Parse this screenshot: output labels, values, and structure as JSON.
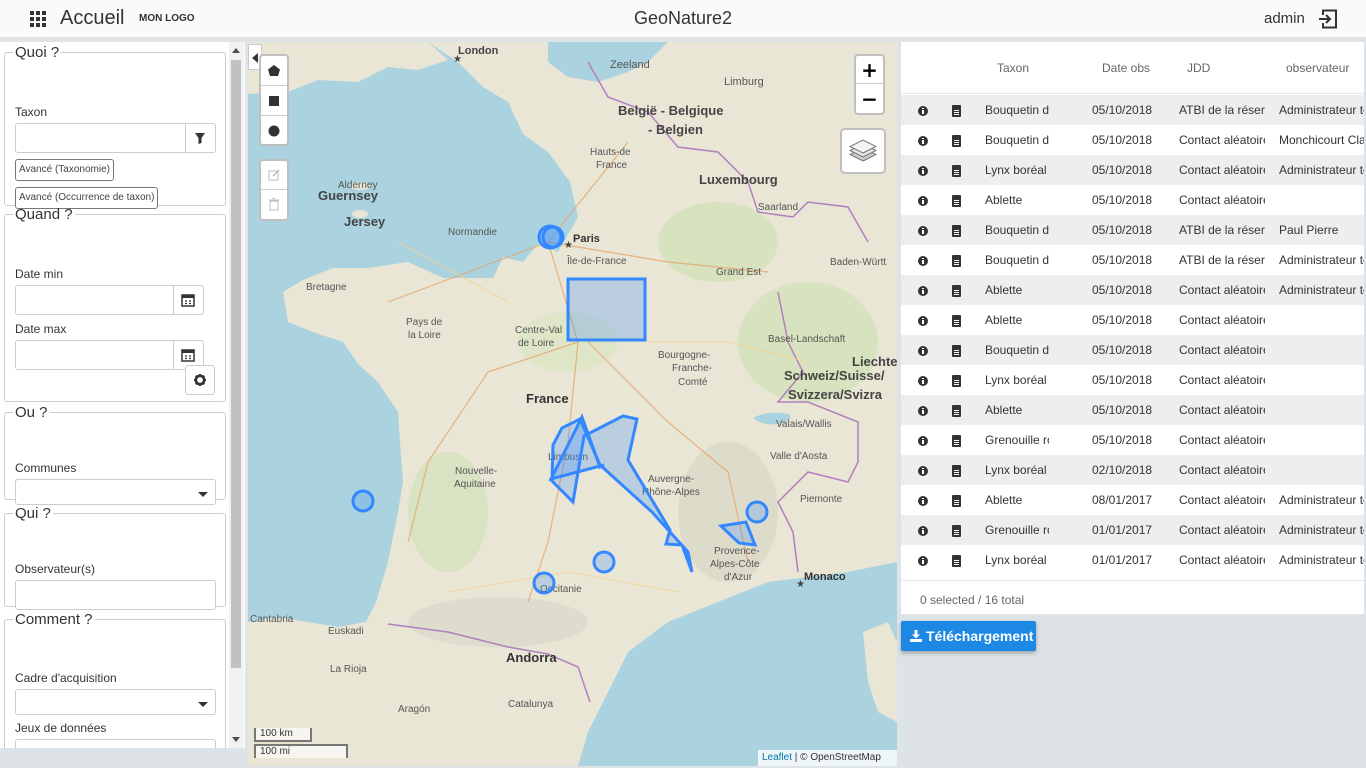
{
  "header": {
    "home_label": "Accueil",
    "logo_text": "MON LOGO",
    "app_title": "GeoNature2",
    "user": "admin"
  },
  "sidebar": {
    "quoi": {
      "legend": "Quoi ?",
      "taxon_label": "Taxon",
      "taxon_value": "",
      "btn_taxonomie": "Avancé (Taxonomie)",
      "btn_occurrence": "Avancé (Occurrence de taxon)"
    },
    "quand": {
      "legend": "Quand ?",
      "date_min_label": "Date min",
      "date_max_label": "Date max"
    },
    "ou": {
      "legend": "Ou ?",
      "communes_label": "Communes"
    },
    "qui": {
      "legend": "Qui ?",
      "observateurs_label": "Observateur(s)"
    },
    "comment": {
      "legend": "Comment ?",
      "cadre_label": "Cadre d'acquisition",
      "jeux_label": "Jeux de données"
    }
  },
  "map": {
    "labels": {
      "london": "London",
      "zeeland": "Zeeland",
      "limburg": "Limburg",
      "belgie1": "België - Belgique",
      "belgie2": "- Belgien",
      "luxembourg": "Luxembourg",
      "guernsey": "Guernsey",
      "jersey": "Jersey",
      "alderney": "Alderney",
      "paris": "Paris",
      "ile_de_france": "Île-de-France",
      "hauts_de_france1": "Hauts-de",
      "hauts_de_france2": "France",
      "normandie": "Normandie",
      "bretagne": "Bretagne",
      "pays_de_la_loire1": "Pays de",
      "pays_de_la_loire2": "la Loire",
      "centre1": "Centre-Val",
      "centre2": "de Loire",
      "grand_est": "Grand Est",
      "saarland": "Saarland",
      "baden": "Baden-Württ",
      "bourgogne1": "Bourgogne-",
      "bourgogne2": "Franche-",
      "bourgogne3": "Comté",
      "france": "France",
      "suisse1": "Schweiz/Suisse/",
      "suisse2": "Svizzera/Svizra",
      "liechte": "Liechte",
      "basel": "Basel-Landschaft",
      "limousin": "Limousin",
      "nouvelle1": "Nouvelle-",
      "nouvelle2": "Aquitaine",
      "auvergne1": "Auvergne-",
      "auvergne2": "Rhône-Alpes",
      "valais": "Valais/Wallis",
      "aoste": "Valle d'Aosta",
      "piemonte": "Piemonte",
      "paca1": "Provence-",
      "paca2": "Alpes-Côte",
      "paca3": "d'Azur",
      "monaco": "Monaco",
      "occitanie": "Occitanie",
      "andorra": "Andorra",
      "cantabria": "Cantabria",
      "euskadi": "Euskadi",
      "la_rioja": "La Rioja",
      "aragon": "Aragón",
      "catalunya": "Catalunya"
    },
    "zoom_in": "+",
    "zoom_out": "−",
    "scale_km": "100 km",
    "scale_mi": "100 mi",
    "attribution_link": "Leaflet",
    "attribution_rest": " | © OpenStreetMap",
    "colors": {
      "water": "#aad3df",
      "land": "#e9e6d6",
      "forest": "#c9dcae",
      "feature": "#3388ff"
    }
  },
  "table": {
    "columns": [
      "Taxon",
      "Date obs",
      "JDD",
      "observateur"
    ],
    "rows": [
      {
        "taxon": "Bouquetin des Alpes",
        "date": "05/10/2018",
        "jdd": "ATBI de la réserve",
        "obs": "Administrateur test"
      },
      {
        "taxon": "Bouquetin des Alpes",
        "date": "05/10/2018",
        "jdd": "Contact aléatoire",
        "obs": "Monchicourt Claire"
      },
      {
        "taxon": "Lynx boréal",
        "date": "05/10/2018",
        "jdd": "Contact aléatoire",
        "obs": "Administrateur test"
      },
      {
        "taxon": "Ablette",
        "date": "05/10/2018",
        "jdd": "Contact aléatoire",
        "obs": ""
      },
      {
        "taxon": "Bouquetin des Alpes",
        "date": "05/10/2018",
        "jdd": "ATBI de la réserve",
        "obs": "Paul Pierre"
      },
      {
        "taxon": "Bouquetin des Alpes",
        "date": "05/10/2018",
        "jdd": "ATBI de la réserve",
        "obs": "Administrateur test"
      },
      {
        "taxon": "Ablette",
        "date": "05/10/2018",
        "jdd": "Contact aléatoire",
        "obs": "Administrateur test"
      },
      {
        "taxon": "Ablette",
        "date": "05/10/2018",
        "jdd": "Contact aléatoire",
        "obs": ""
      },
      {
        "taxon": "Bouquetin des Alpes",
        "date": "05/10/2018",
        "jdd": "Contact aléatoire",
        "obs": ""
      },
      {
        "taxon": "Lynx boréal",
        "date": "05/10/2018",
        "jdd": "Contact aléatoire",
        "obs": ""
      },
      {
        "taxon": "Ablette",
        "date": "05/10/2018",
        "jdd": "Contact aléatoire",
        "obs": ""
      },
      {
        "taxon": "Grenouille rousse",
        "date": "05/10/2018",
        "jdd": "Contact aléatoire",
        "obs": ""
      },
      {
        "taxon": "Lynx boréal",
        "date": "02/10/2018",
        "jdd": "Contact aléatoire",
        "obs": ""
      },
      {
        "taxon": "Ablette",
        "date": "08/01/2017",
        "jdd": "Contact aléatoire",
        "obs": "Administrateur test"
      },
      {
        "taxon": "Grenouille rousse",
        "date": "01/01/2017",
        "jdd": "Contact aléatoire",
        "obs": "Administrateur test"
      },
      {
        "taxon": "Lynx boréal",
        "date": "01/01/2017",
        "jdd": "Contact aléatoire",
        "obs": "Administrateur test"
      }
    ],
    "footer": "0 selected / 16 total"
  },
  "download_label": "Téléchargement",
  "icons": {
    "apps": "apps-grid-icon",
    "logout": "logout-icon",
    "filter": "filter-icon",
    "calendar": "calendar-icon",
    "gear": "gear-icon",
    "info": "info-icon",
    "file": "file-icon",
    "download": "download-icon",
    "layers": "layers-icon"
  }
}
